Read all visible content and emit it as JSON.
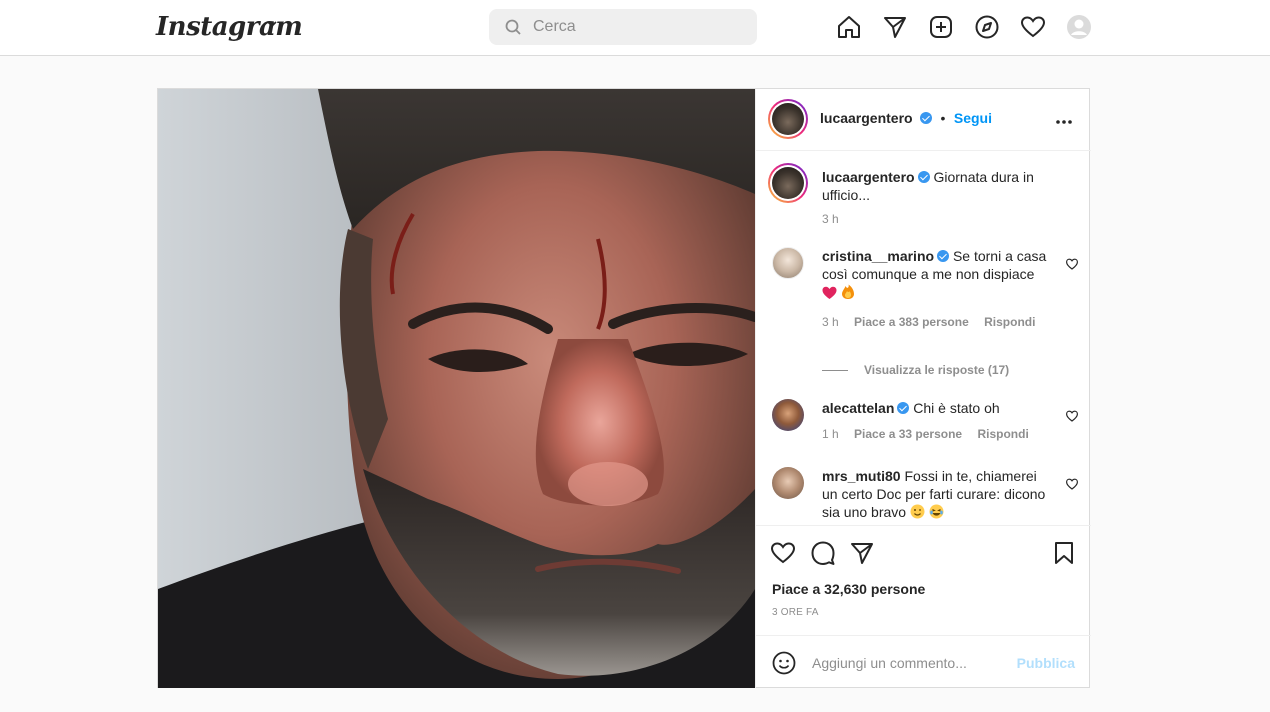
{
  "nav": {
    "logo": "Instagram",
    "search_placeholder": "Cerca"
  },
  "post": {
    "author": "lucaargentero",
    "follow_label": "Segui",
    "caption": {
      "username": "lucaargentero",
      "text": "Giornata dura in ufficio...",
      "time": "3 h"
    },
    "comments": [
      {
        "username": "cristina__marino",
        "verified": true,
        "text": "Se torni a casa così comunque a me non dispiace",
        "emojis": [
          "red-heart",
          "fire"
        ],
        "time": "3 h",
        "likes": "Piace a 383 persone",
        "reply": "Rispondi"
      },
      {
        "username": "alecattelan",
        "verified": true,
        "text": "Chi è stato oh",
        "time": "1 h",
        "likes": "Piace a 33 persone",
        "reply": "Rispondi"
      },
      {
        "username": "mrs_muti80",
        "verified": false,
        "text": "Fossi in te, chiamerei un certo Doc per farti curare: dicono sia uno bravo",
        "emojis": [
          "wink-face",
          "laughing-face"
        ]
      }
    ],
    "view_replies": "Visualizza le risposte (17)",
    "likes_total": "Piace a 32,630 persone",
    "posted_ago": "3 ORE FA",
    "add_comment_placeholder": "Aggiungi un commento...",
    "publish_label": "Pubblica"
  },
  "colors": {
    "link_blue": "#0095f6",
    "publish_disabled": "#b2dffc",
    "muted": "#8e8e8e",
    "verified": "#3897f0"
  }
}
